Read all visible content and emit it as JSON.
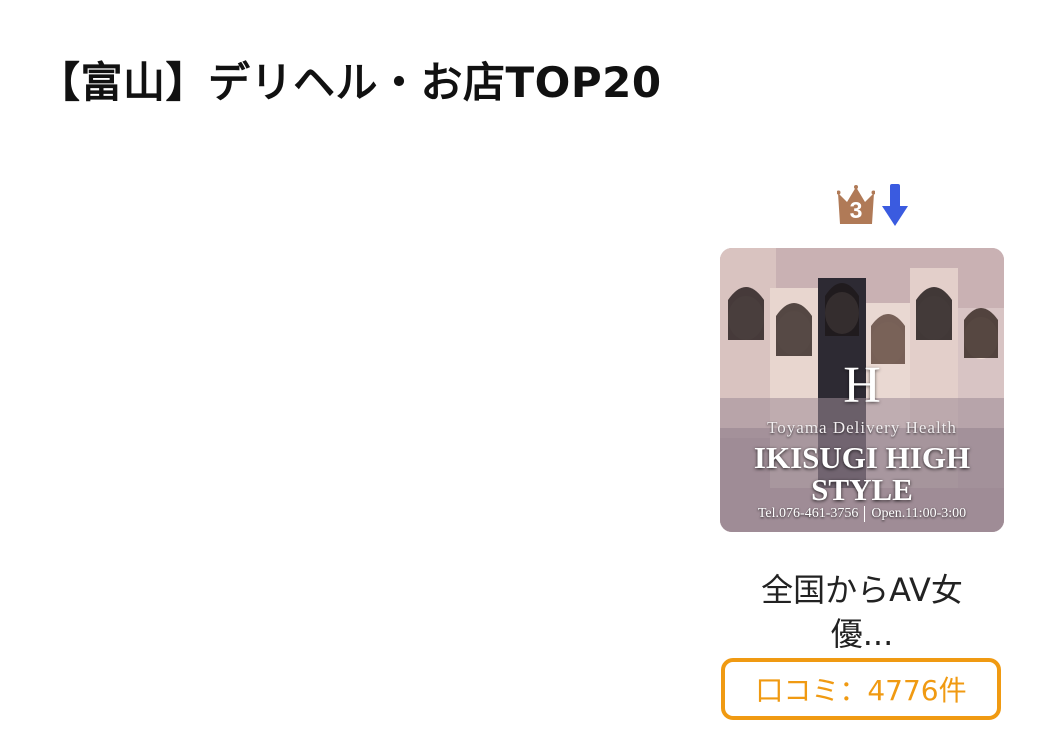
{
  "page": {
    "title": "【富山】デリヘル・お店TOP20"
  },
  "shop": {
    "rank": "3",
    "rank_trend": "down",
    "crown_color": "#b07a57",
    "trend_color": "#3a5be0",
    "banner": {
      "logo_mark": "H",
      "tagline": "Toyama Delivery Health",
      "name_line1": "IKISUGI HIGH",
      "name_line2": "STYLE",
      "tel": "Tel.076-461-3756",
      "open": "Open.11:00-3:00"
    },
    "description_line1": "全国からAV女",
    "description_line2": "優...",
    "reviews_label": "口コミ：4776件",
    "accent_color": "#f09a12"
  }
}
